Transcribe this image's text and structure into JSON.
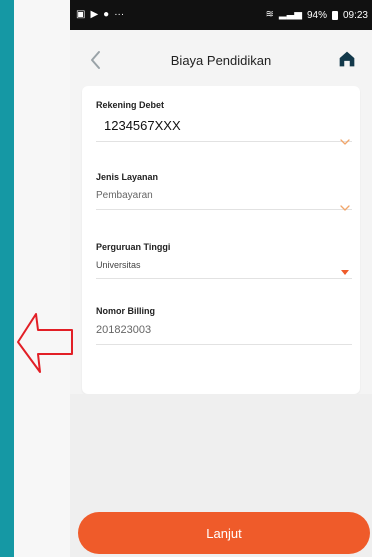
{
  "status_bar": {
    "left_icons": [
      "image-icon",
      "play-icon",
      "circle-icon",
      "more-icon"
    ],
    "battery_text": "94%",
    "time": "09:23"
  },
  "header": {
    "title": "Biaya Pendidikan"
  },
  "form": {
    "rekening": {
      "label": "Rekening Debet",
      "value": "1234567XXX"
    },
    "jenis_layanan": {
      "label": "Jenis Layanan",
      "value": "Pembayaran"
    },
    "perguruan_tinggi": {
      "label": "Perguruan Tinggi",
      "value": "Universitas"
    },
    "nomor_billing": {
      "label": "Nomor Billing",
      "value": "201823003"
    }
  },
  "actions": {
    "submit_label": "Lanjut"
  },
  "colors": {
    "accent_orange": "#ef5b2a",
    "teal_border": "#1a9aa6",
    "annotation_red": "#e21f26"
  }
}
